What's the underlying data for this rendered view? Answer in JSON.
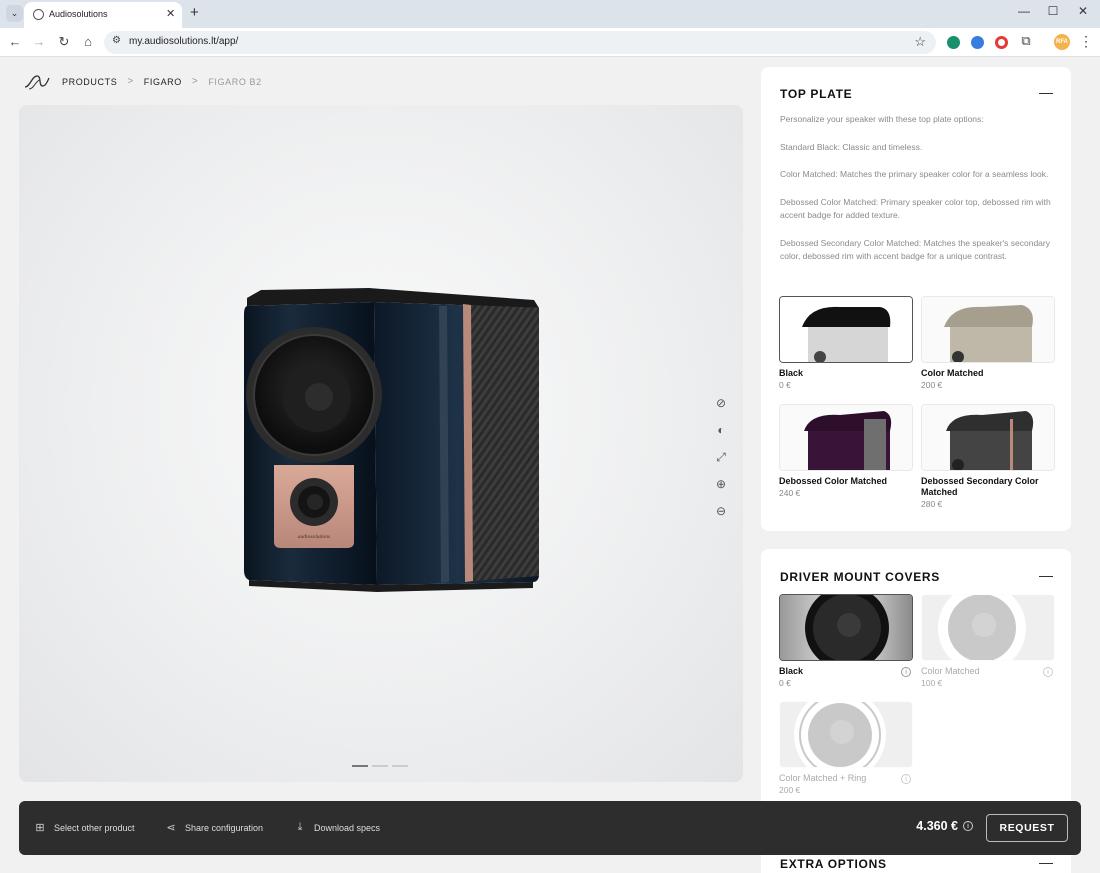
{
  "browser": {
    "tab_title": "Audiosolutions",
    "tab_close": "✕",
    "new_tab": "+",
    "url": "my.audiosolutions.lt/app/",
    "window_minimize": "—",
    "window_maximize": "☐",
    "window_close": "✕",
    "profile_initials": "RFA"
  },
  "breadcrumb": {
    "items": [
      "PRODUCTS",
      "FIGARO",
      "FIGARO B2"
    ],
    "separator": ">"
  },
  "viewer": {
    "tools": [
      "hide-icon",
      "contrast-icon",
      "fullscreen-icon",
      "zoom-in-icon",
      "zoom-out-icon"
    ],
    "pagination": {
      "count": 3,
      "active": 0
    },
    "speaker_brand": "audiosolutions"
  },
  "top_plate": {
    "title": "TOP PLATE",
    "collapse": "—",
    "description": [
      "Personalize your speaker with these top plate options:",
      "Standard Black: Classic and timeless.",
      "Color Matched: Matches the primary speaker color for a seamless look.",
      "Debossed Color Matched: Primary speaker color top, debossed rim with accent badge for added texture.",
      "Debossed Secondary Color Matched: Matches the speaker's secondary color, debossed rim with accent badge for a unique contrast."
    ],
    "options": [
      {
        "name": "Black",
        "price": "0 €",
        "selected": true
      },
      {
        "name": "Color Matched",
        "price": "200 €",
        "selected": false
      },
      {
        "name": "Debossed Color Matched",
        "price": "240 €",
        "selected": false
      },
      {
        "name": "Debossed Secondary Color Matched",
        "price": "280 €",
        "selected": false
      }
    ]
  },
  "driver_mount_covers": {
    "title": "DRIVER MOUNT COVERS",
    "collapse": "—",
    "options": [
      {
        "name": "Black",
        "price": "0 €",
        "selected": true,
        "available": true
      },
      {
        "name": "Color Matched",
        "price": "100 €",
        "selected": false,
        "available": false
      },
      {
        "name": "Color Matched + Ring",
        "price": "200 €",
        "selected": false,
        "available": false
      }
    ]
  },
  "extra_options": {
    "title": "EXTRA OPTIONS",
    "collapse": "—"
  },
  "bottom_bar": {
    "select_product": "Select other product",
    "share": "Share configuration",
    "download": "Download specs",
    "total": "4.360 €",
    "request": "REQUEST"
  },
  "colors": {
    "speaker_body": "#0f1c2b",
    "accent_strip": "#b98a7c",
    "bottom_bar": "#2d2d2d"
  }
}
